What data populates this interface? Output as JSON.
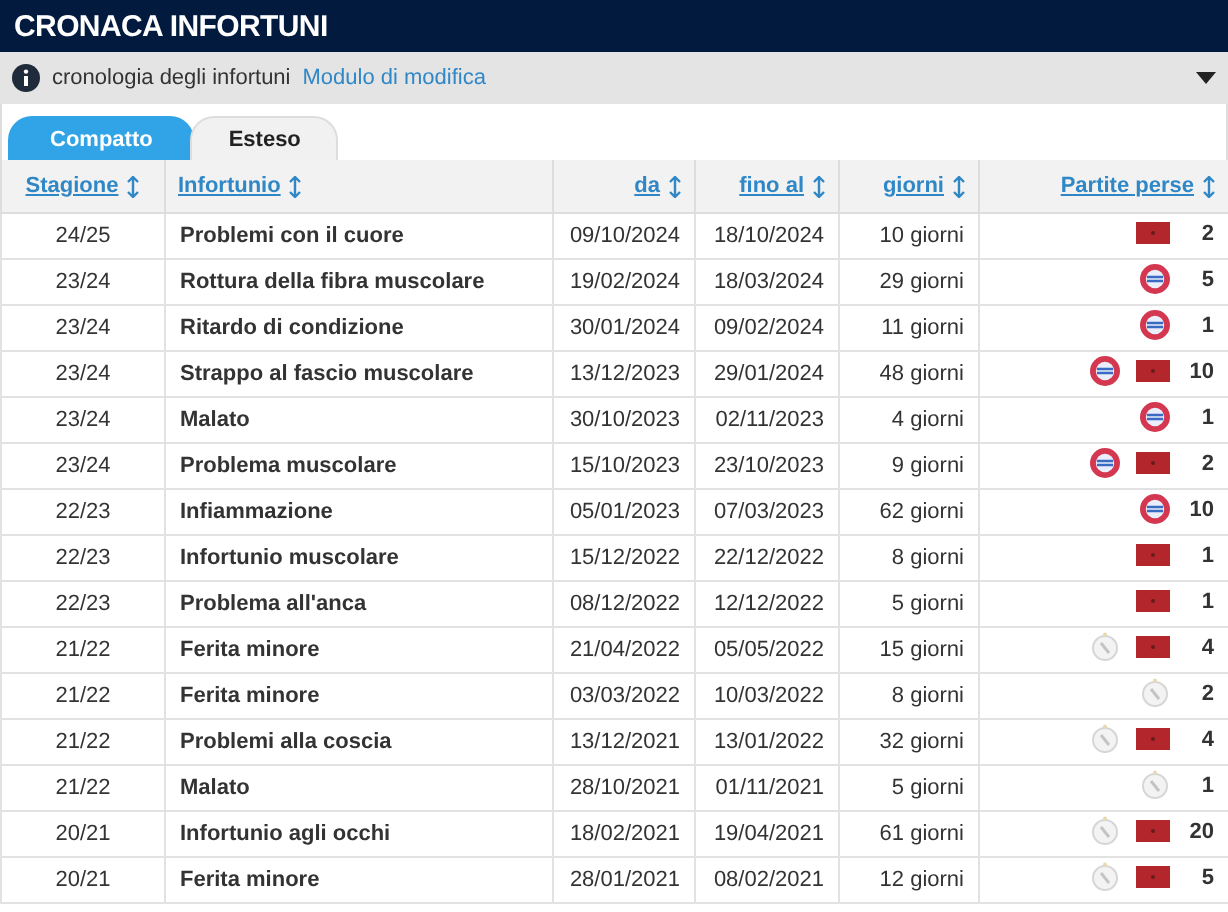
{
  "title": "CRONACA INFORTUNI",
  "info": {
    "text": "cronologia degli infortuni",
    "link": "Modulo di modifica"
  },
  "tabs": [
    {
      "label": "Compatto",
      "selected": true
    },
    {
      "label": "Esteso",
      "selected": false
    }
  ],
  "table": {
    "columns": [
      {
        "label": "Stagione"
      },
      {
        "label": "Infortunio"
      },
      {
        "label": "da"
      },
      {
        "label": "fino al"
      },
      {
        "label": "giorni"
      },
      {
        "label": "Partite perse"
      }
    ],
    "rows": [
      {
        "season": "24/25",
        "injury": "Problemi con il cuore",
        "from": "09/10/2024",
        "until": "18/10/2024",
        "days": "10 giorni",
        "badges": [
          {
            "kind": "flag"
          }
        ],
        "games": "2"
      },
      {
        "season": "23/24",
        "injury": "Rottura della fibra muscolare",
        "from": "19/02/2024",
        "until": "18/03/2024",
        "days": "29 giorni",
        "badges": [
          {
            "kind": "red_crest"
          }
        ],
        "games": "5"
      },
      {
        "season": "23/24",
        "injury": "Ritardo di condizione",
        "from": "30/01/2024",
        "until": "09/02/2024",
        "days": "11 giorni",
        "badges": [
          {
            "kind": "red_crest"
          }
        ],
        "games": "1"
      },
      {
        "season": "23/24",
        "injury": "Strappo al fascio muscolare",
        "from": "13/12/2023",
        "until": "29/01/2024",
        "days": "48 giorni",
        "badges": [
          {
            "kind": "red_crest"
          },
          {
            "kind": "flag"
          }
        ],
        "games": "10"
      },
      {
        "season": "23/24",
        "injury": "Malato",
        "from": "30/10/2023",
        "until": "02/11/2023",
        "days": "4 giorni",
        "badges": [
          {
            "kind": "red_crest"
          }
        ],
        "games": "1"
      },
      {
        "season": "23/24",
        "injury": "Problema muscolare",
        "from": "15/10/2023",
        "until": "23/10/2023",
        "days": "9 giorni",
        "badges": [
          {
            "kind": "red_crest"
          },
          {
            "kind": "flag"
          }
        ],
        "games": "2"
      },
      {
        "season": "22/23",
        "injury": "Infiammazione",
        "from": "05/01/2023",
        "until": "07/03/2023",
        "days": "62 giorni",
        "badges": [
          {
            "kind": "red_crest"
          }
        ],
        "games": "10"
      },
      {
        "season": "22/23",
        "injury": "Infortunio muscolare",
        "from": "15/12/2022",
        "until": "22/12/2022",
        "days": "8 giorni",
        "badges": [
          {
            "kind": "flag"
          }
        ],
        "games": "1"
      },
      {
        "season": "22/23",
        "injury": "Problema all'anca",
        "from": "08/12/2022",
        "until": "12/12/2022",
        "days": "5 giorni",
        "badges": [
          {
            "kind": "flag"
          }
        ],
        "games": "1"
      },
      {
        "season": "21/22",
        "injury": "Ferita minore",
        "from": "21/04/2022",
        "until": "05/05/2022",
        "days": "15 giorni",
        "badges": [
          {
            "kind": "white_crest"
          },
          {
            "kind": "flag"
          }
        ],
        "games": "4"
      },
      {
        "season": "21/22",
        "injury": "Ferita minore",
        "from": "03/03/2022",
        "until": "10/03/2022",
        "days": "8 giorni",
        "badges": [
          {
            "kind": "white_crest"
          }
        ],
        "games": "2"
      },
      {
        "season": "21/22",
        "injury": "Problemi alla coscia",
        "from": "13/12/2021",
        "until": "13/01/2022",
        "days": "32 giorni",
        "badges": [
          {
            "kind": "white_crest"
          },
          {
            "kind": "flag"
          }
        ],
        "games": "4"
      },
      {
        "season": "21/22",
        "injury": "Malato",
        "from": "28/10/2021",
        "until": "01/11/2021",
        "days": "5 giorni",
        "badges": [
          {
            "kind": "white_crest"
          }
        ],
        "games": "1"
      },
      {
        "season": "20/21",
        "injury": "Infortunio agli occhi",
        "from": "18/02/2021",
        "until": "19/04/2021",
        "days": "61 giorni",
        "badges": [
          {
            "kind": "white_crest"
          },
          {
            "kind": "flag"
          }
        ],
        "games": "20"
      },
      {
        "season": "20/21",
        "injury": "Ferita minore",
        "from": "28/01/2021",
        "until": "08/02/2021",
        "days": "12 giorni",
        "badges": [
          {
            "kind": "white_crest"
          },
          {
            "kind": "flag"
          }
        ],
        "games": "5"
      }
    ]
  }
}
